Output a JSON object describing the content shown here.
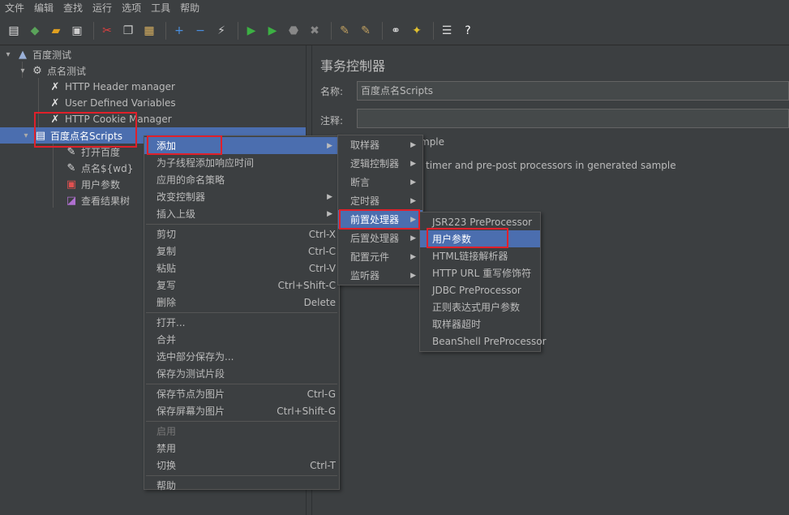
{
  "menubar": [
    "文件",
    "编辑",
    "查找",
    "运行",
    "选项",
    "工具",
    "帮助"
  ],
  "toolbar": [
    {
      "icon": "new-icon",
      "glyph": "▤",
      "color": "#e8e8e8"
    },
    {
      "icon": "templates-icon",
      "glyph": "◆",
      "color": "#5aa35a"
    },
    {
      "icon": "open-icon",
      "glyph": "▰",
      "color": "#e0a020"
    },
    {
      "icon": "save-icon",
      "glyph": "▣",
      "color": "#cccccc"
    },
    {
      "sep": true
    },
    {
      "icon": "cut-icon",
      "glyph": "✂",
      "color": "#e04040"
    },
    {
      "icon": "copy-icon",
      "glyph": "❐",
      "color": "#cccccc"
    },
    {
      "icon": "paste-icon",
      "glyph": "▦",
      "color": "#d8b060"
    },
    {
      "sep": true
    },
    {
      "icon": "expand-icon",
      "glyph": "+",
      "color": "#4a90e2"
    },
    {
      "icon": "collapse-icon",
      "glyph": "−",
      "color": "#4a90e2"
    },
    {
      "icon": "toggle-icon",
      "glyph": "⚡",
      "color": "#cccccc"
    },
    {
      "sep": true
    },
    {
      "icon": "start-icon",
      "glyph": "▶",
      "color": "#3cb043"
    },
    {
      "icon": "start-no-pause-icon",
      "glyph": "▶",
      "color": "#3cb043"
    },
    {
      "icon": "stop-icon",
      "glyph": "⬣",
      "color": "#888888"
    },
    {
      "icon": "shutdown-icon",
      "glyph": "✖",
      "color": "#888888"
    },
    {
      "sep": true
    },
    {
      "icon": "clear-icon",
      "glyph": "✎",
      "color": "#c0a060"
    },
    {
      "icon": "clear-all-icon",
      "glyph": "✎",
      "color": "#c0a060"
    },
    {
      "sep": true
    },
    {
      "icon": "search-icon",
      "glyph": "⚭",
      "color": "#dddddd"
    },
    {
      "icon": "reset-search-icon",
      "glyph": "✦",
      "color": "#e0c030"
    },
    {
      "sep": true
    },
    {
      "icon": "function-helper-icon",
      "glyph": "☰",
      "color": "#dddddd"
    },
    {
      "icon": "help-icon",
      "glyph": "?",
      "color": "#ffffff"
    }
  ],
  "tree": {
    "items": [
      {
        "label": "百度测试",
        "icon": "test-plan-icon",
        "glyph": "▲",
        "color": "#9ab0d8"
      },
      {
        "label": "点名测试",
        "icon": "thread-group-icon",
        "glyph": "⚙",
        "color": "#cccccc"
      },
      {
        "label": "HTTP Header manager",
        "icon": "config-tool-icon",
        "glyph": "✗",
        "color": "#e0e0e0"
      },
      {
        "label": "User Defined Variables",
        "icon": "config-tool-icon",
        "glyph": "✗",
        "color": "#e0e0e0"
      },
      {
        "label": "HTTP Cookie Manager",
        "icon": "config-tool-icon",
        "glyph": "✗",
        "color": "#e0e0e0"
      },
      {
        "label": "百度点名Scripts",
        "icon": "transaction-controller-icon",
        "glyph": "▤",
        "color": "#ffffff"
      },
      {
        "label": "打开百度",
        "icon": "sampler-icon",
        "glyph": "✎",
        "color": "#dddddd"
      },
      {
        "label": "点名${wd}",
        "icon": "sampler-icon",
        "glyph": "✎",
        "color": "#dddddd"
      },
      {
        "label": "用户参数",
        "icon": "preprocessor-icon",
        "glyph": "▣",
        "color": "#e05050"
      },
      {
        "label": "查看结果树",
        "icon": "listener-icon",
        "glyph": "◪",
        "color": "#b070d0"
      }
    ]
  },
  "panel": {
    "title": "事务控制器",
    "name_label": "名称:",
    "name_value": "百度点名Scripts",
    "comment_label": "注释:",
    "comment_value": "",
    "option1_fragment": "mple",
    "option2_fragment": "timer and pre-post processors in generated sample"
  },
  "context_menu": {
    "items": [
      {
        "label": "添加",
        "sub": true,
        "hl": true
      },
      {
        "label": "为子线程添加响应时间"
      },
      {
        "label": "应用的命名策略"
      },
      {
        "label": "改变控制器",
        "sub": true
      },
      {
        "label": "插入上级",
        "sub": true
      },
      {
        "sep": true
      },
      {
        "label": "剪切",
        "sc": "Ctrl-X"
      },
      {
        "label": "复制",
        "sc": "Ctrl-C"
      },
      {
        "label": "粘贴",
        "sc": "Ctrl-V"
      },
      {
        "label": "复写",
        "sc": "Ctrl+Shift-C"
      },
      {
        "label": "删除",
        "sc": "Delete"
      },
      {
        "sep": true
      },
      {
        "label": "打开..."
      },
      {
        "label": "合并"
      },
      {
        "label": "选中部分保存为..."
      },
      {
        "label": "保存为测试片段"
      },
      {
        "sep": true
      },
      {
        "label": "保存节点为图片",
        "sc": "Ctrl-G"
      },
      {
        "label": "保存屏幕为图片",
        "sc": "Ctrl+Shift-G"
      },
      {
        "sep": true
      },
      {
        "label": "启用",
        "dis": true
      },
      {
        "label": "禁用"
      },
      {
        "label": "切换",
        "sc": "Ctrl-T"
      },
      {
        "sep": true
      },
      {
        "label": "帮助"
      }
    ]
  },
  "add_submenu": {
    "items": [
      {
        "label": "取样器",
        "sub": true
      },
      {
        "label": "逻辑控制器",
        "sub": true
      },
      {
        "label": "断言",
        "sub": true
      },
      {
        "label": "定时器",
        "sub": true
      },
      {
        "label": "前置处理器",
        "sub": true,
        "hl": true
      },
      {
        "label": "后置处理器",
        "sub": true
      },
      {
        "label": "配置元件",
        "sub": true
      },
      {
        "label": "监听器",
        "sub": true
      }
    ]
  },
  "preprocessor_submenu": {
    "items": [
      {
        "label": "JSR223 PreProcessor"
      },
      {
        "label": "用户参数",
        "hl": true
      },
      {
        "label": "HTML链接解析器"
      },
      {
        "label": "HTTP URL 重写修饰符"
      },
      {
        "label": "JDBC PreProcessor"
      },
      {
        "label": "正则表达式用户参数"
      },
      {
        "label": "取样器超时"
      },
      {
        "label": "BeanShell PreProcessor"
      }
    ]
  },
  "colors": {
    "background": "#3c3f41",
    "highlight": "#4b6eaf",
    "annotation": "#e0202a",
    "text": "#bbbbbb"
  }
}
